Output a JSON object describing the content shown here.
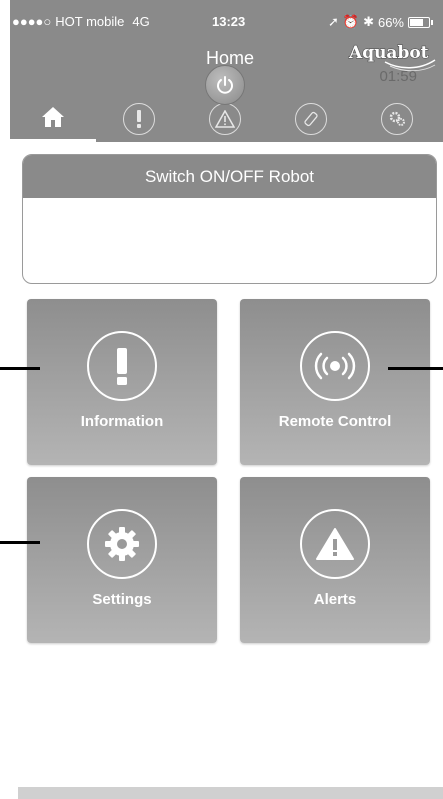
{
  "status_bar": {
    "carrier": "HOT mobile",
    "network": "4G",
    "time": "13:23",
    "battery_percent": "66%"
  },
  "header": {
    "title": "Home",
    "logo_text": "Aquabot"
  },
  "tabs": [
    {
      "icon": "home-icon",
      "active": true
    },
    {
      "icon": "exclamation-icon",
      "active": false
    },
    {
      "icon": "warning-icon",
      "active": false
    },
    {
      "icon": "remote-icon",
      "active": false
    },
    {
      "icon": "gears-icon",
      "active": false
    }
  ],
  "switch_card": {
    "title": "Switch ON/OFF Robot",
    "timer": "01:59"
  },
  "tiles": [
    {
      "label": "Information",
      "icon": "exclamation-icon"
    },
    {
      "label": "Remote Control",
      "icon": "signal-icon"
    },
    {
      "label": "Settings",
      "icon": "gear-icon"
    },
    {
      "label": "Alerts",
      "icon": "warning-icon"
    }
  ],
  "colors": {
    "header": "#8a8a8a",
    "tile_top": "#8e8e8e",
    "tile_bottom": "#b4b4b4"
  }
}
